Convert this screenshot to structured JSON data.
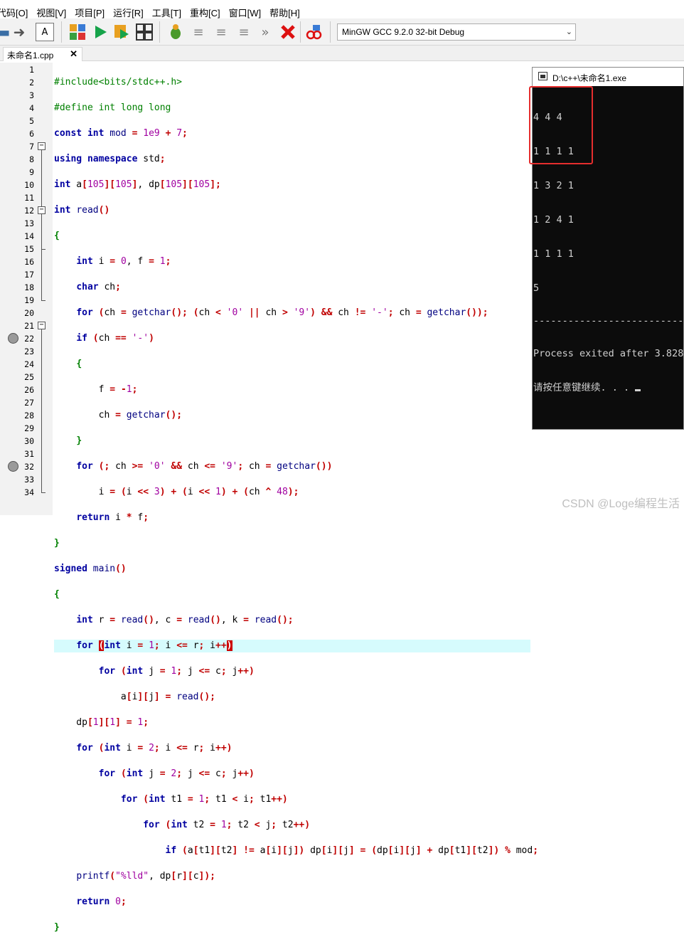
{
  "menu": [
    "代码[O]",
    "视图[V]",
    "项目[P]",
    "运行[R]",
    "工具[T]",
    "重构[C]",
    "窗口[W]",
    "帮助[H]"
  ],
  "toolbar": {
    "compiler": "MinGW GCC 9.2.0 32-bit Debug"
  },
  "tab": {
    "label": "未命名1.cpp",
    "close": "✕"
  },
  "line_numbers": [
    "1",
    "2",
    "3",
    "4",
    "5",
    "6",
    "7",
    "8",
    "9",
    "10",
    "11",
    "12",
    "13",
    "14",
    "15",
    "16",
    "17",
    "18",
    "19",
    "20",
    "21",
    "22",
    "23",
    "24",
    "25",
    "26",
    "27",
    "28",
    "29",
    "30",
    "31",
    "32",
    "33",
    "34"
  ],
  "console": {
    "title": "D:\\c++\\未命名1.exe",
    "output_lines": [
      "4 4 4",
      "1 1 1 1",
      "1 3 2 1",
      "1 2 4 1",
      "1 1 1 1",
      "5"
    ],
    "dashes": "--------------------------------",
    "exit_message": "Process exited after 3.828",
    "press_key": "请按任意键继续. . . "
  },
  "watermark": "CSDN @Loge编程生活",
  "colors": {
    "highlight_line": "#d6fbfd",
    "keyword": "#0000a0",
    "number": "#a000a0",
    "operator": "#c00000",
    "preprocessor": "#008000",
    "brace": "#008000"
  }
}
